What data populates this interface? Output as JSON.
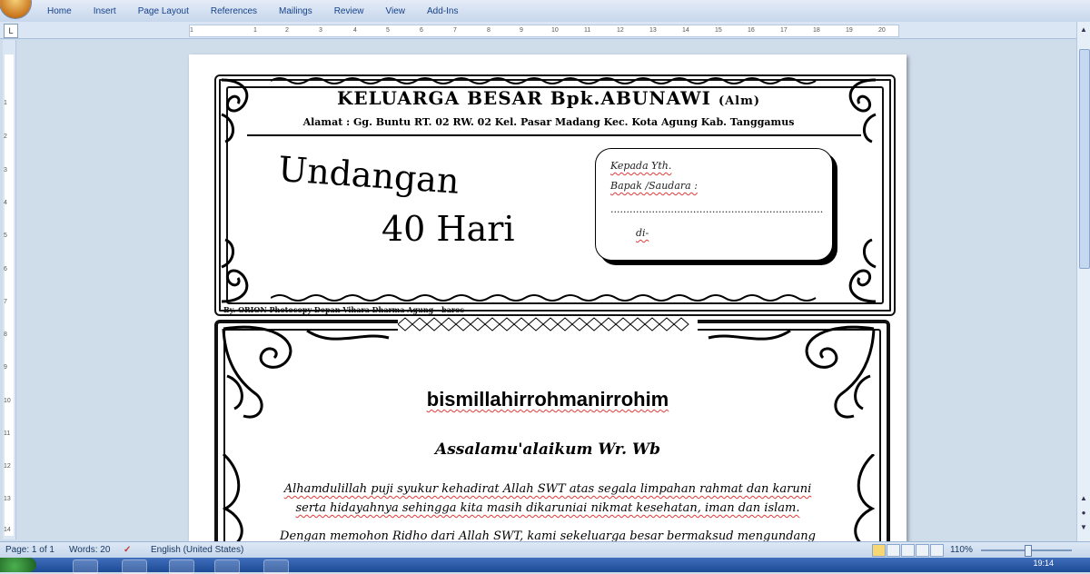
{
  "menu": [
    "Home",
    "Insert",
    "Page Layout",
    "References",
    "Mailings",
    "Review",
    "View",
    "Add-Ins"
  ],
  "ruler": {
    "corner": "L",
    "h_ticks": [
      "1",
      "1",
      "2",
      "3",
      "4",
      "5",
      "6",
      "7",
      "8",
      "9",
      "10",
      "11",
      "12",
      "13",
      "14",
      "15",
      "16",
      "17",
      "18",
      "19",
      "20"
    ],
    "v_ticks": [
      "1",
      "2",
      "3",
      "4",
      "5",
      "6",
      "7",
      "8",
      "9",
      "10",
      "11",
      "12",
      "13",
      "14"
    ]
  },
  "document": {
    "family_title": "KELUARGA BESAR Bpk.ABUNAWI",
    "family_suffix": "(Alm)",
    "address": "Alamat : Gg. Buntu RT. 02 RW. 02 Kel. Pasar Madang Kec. Kota Agung Kab. Tanggamus",
    "title_line1": "Undangan",
    "title_line2": "40 Hari",
    "recipient": {
      "line1": "Kepada Yth.",
      "line2": "Bapak /Saudara  :",
      "dots": "...................................................................",
      "line4": "di-"
    },
    "credit": "By. ORION Photocopy Depan Vihara Dharma Agung - baros",
    "heading": "bismillahirrohmanirrohim",
    "greeting": "Assalamu'alaikum Wr. Wb",
    "paragraph_line1": "Alhamdulillah puji syukur kehadirat Allah SWT atas segala limpahan rahmat dan karuni",
    "paragraph_line2": "serta hidayahnya sehingga kita masih dikaruniai nikmat kesehatan, iman dan islam.",
    "paragraph_line3": "Dengan memohon Ridho dari Allah SWT, kami sekeluarga besar bermaksud mengundang"
  },
  "status": {
    "page": "Page: 1 of 1",
    "words": "Words: 20",
    "language": "English (United States)",
    "zoom": "110%",
    "clock": "19:14"
  },
  "colors": {
    "ribbon_text": "#15428b",
    "spell_underline": "#e23a3a",
    "taskbar": "#1d4a94"
  }
}
